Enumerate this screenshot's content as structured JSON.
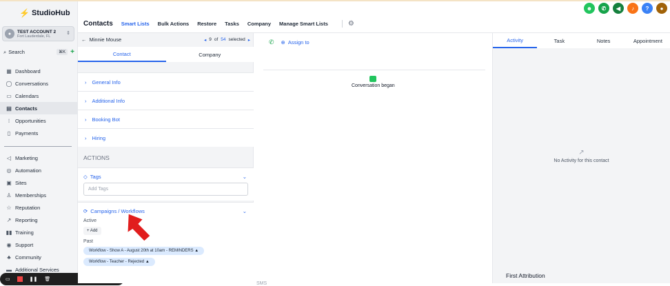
{
  "app": {
    "logo_text": "StudioHub"
  },
  "account": {
    "name": "TEST ACCOUNT 2",
    "location": "Fort Lauderdale, FL"
  },
  "search": {
    "label": "Search",
    "shortcut": "⌘K"
  },
  "sidebar": {
    "items": [
      {
        "label": "Dashboard",
        "icon": "grid-icon"
      },
      {
        "label": "Conversations",
        "icon": "chat-icon"
      },
      {
        "label": "Calendars",
        "icon": "calendar-icon"
      },
      {
        "label": "Contacts",
        "icon": "contacts-icon",
        "active": true
      },
      {
        "label": "Opportunities",
        "icon": "funnel-icon"
      },
      {
        "label": "Payments",
        "icon": "payments-icon"
      },
      {
        "label": "Marketing",
        "icon": "send-icon"
      },
      {
        "label": "Automation",
        "icon": "automation-icon"
      },
      {
        "label": "Sites",
        "icon": "sites-icon"
      },
      {
        "label": "Memberships",
        "icon": "membership-icon"
      },
      {
        "label": "Reputation",
        "icon": "star-icon"
      },
      {
        "label": "Reporting",
        "icon": "chart-icon"
      },
      {
        "label": "Training",
        "icon": "book-icon"
      },
      {
        "label": "Support",
        "icon": "support-icon"
      },
      {
        "label": "Community",
        "icon": "community-icon"
      },
      {
        "label": "Additional Services",
        "icon": "services-icon"
      }
    ]
  },
  "header": {
    "title": "Contacts",
    "links": [
      "Smart Lists",
      "Bulk Actions",
      "Restore",
      "Tasks",
      "Company",
      "Manage Smart Lists"
    ]
  },
  "contact": {
    "name": "Minnie Mouse",
    "pager": {
      "current": "9",
      "of_label": "of",
      "total": "54",
      "selected_label": "selected"
    },
    "tabs": [
      "Contact",
      "Company"
    ],
    "sections": [
      "General Info",
      "Additional Info",
      "Booking Bot",
      "Hiring"
    ],
    "actions_label": "ACTIONS",
    "tags_label": "Tags",
    "tags_placeholder": "Add Tags",
    "campaigns_label": "Campaigns / Workflows",
    "active_label": "Active",
    "add_label": "+ Add",
    "past_label": "Past",
    "past_workflows": [
      "Workflow - Show A - August 20th at 10am - REMINDERS",
      "Workflow - Teacher - Rejected"
    ]
  },
  "conversation": {
    "assign_label": "Assign to",
    "began_label": "Conversation began",
    "channel_label": "SMS"
  },
  "activity": {
    "tabs": [
      "Activity",
      "Task",
      "Notes",
      "Appointment"
    ],
    "empty_label": "No Activity for this contact",
    "first_attribution_label": "First Attribution"
  },
  "colors": {
    "accent": "#2563eb",
    "green": "#16a34a",
    "arrow": "#e11d1d"
  }
}
